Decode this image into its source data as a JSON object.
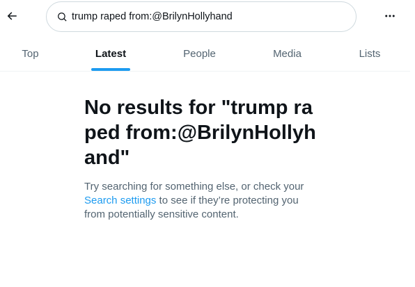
{
  "search": {
    "value": "trump raped from:@BrilynHollyhand"
  },
  "tabs": [
    {
      "label": "Top",
      "active": false
    },
    {
      "label": "Latest",
      "active": true
    },
    {
      "label": "People",
      "active": false
    },
    {
      "label": "Media",
      "active": false
    },
    {
      "label": "Lists",
      "active": false
    }
  ],
  "empty_state": {
    "title": "No results for \"trump raped from:@BrilynHollyhand\"",
    "desc_before": "Try searching for something else, or check your ",
    "link": "Search settings",
    "desc_after": " to see if they’re protecting you from potentially sensitive content."
  },
  "colors": {
    "accent": "#1d9bf0",
    "text_primary": "#0f1419",
    "text_secondary": "#536471"
  },
  "icons": {
    "back": "arrow-left",
    "search": "magnifier",
    "more": "ellipsis-horizontal"
  }
}
